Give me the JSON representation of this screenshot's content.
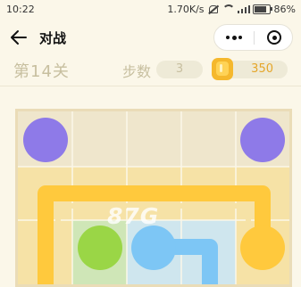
{
  "status_bar": {
    "time": "10:22",
    "speed": "1.70K/s",
    "battery": "86%"
  },
  "header": {
    "title": "对战"
  },
  "info": {
    "level": "第14关",
    "steps_label": "步数",
    "steps_value": "3",
    "coins": "350"
  },
  "board": {
    "colors": {
      "purple": "#8e7ae8",
      "yellow": "#ffc93d",
      "green": "#9ad646",
      "blue": "#7dc6f5",
      "grid": "#fbf7e9",
      "yellow_fill": "#f6e2a6",
      "green_fill": "#cfe6b7",
      "blue_fill": "#cfe6ee"
    }
  },
  "watermark": "87G"
}
